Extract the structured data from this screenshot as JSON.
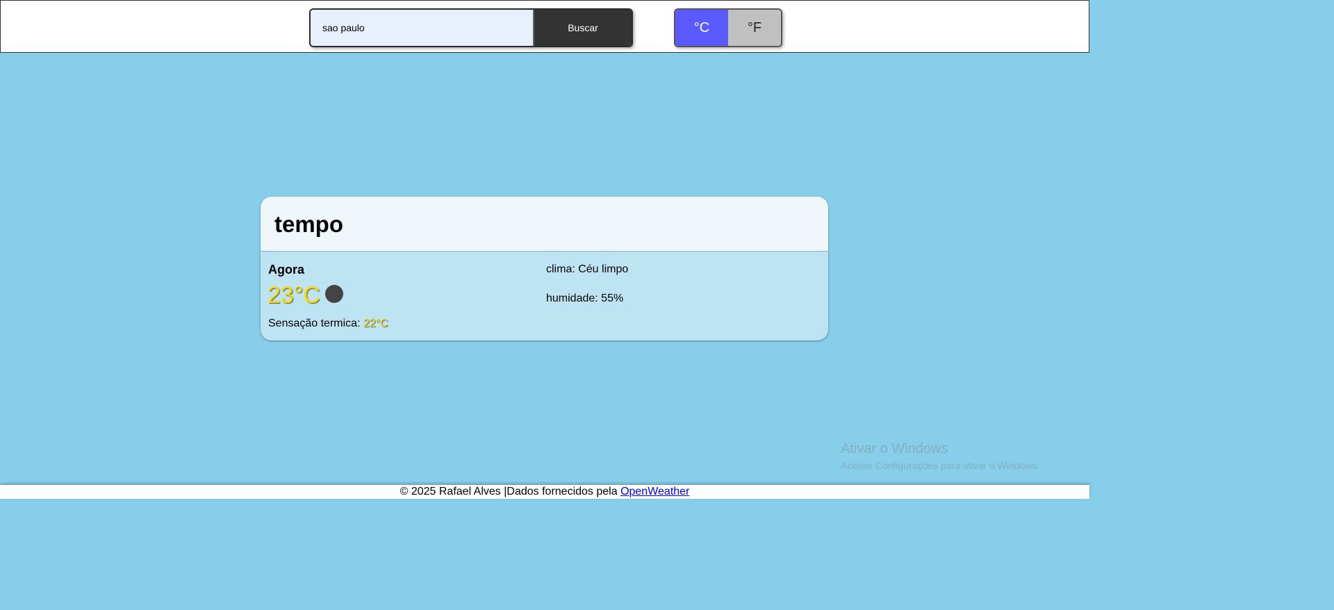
{
  "search": {
    "value": "sao paulo",
    "button_label": "Buscar"
  },
  "units": {
    "celsius_label": "°C",
    "fahrenheit_label": "°F",
    "selected": "°C"
  },
  "card": {
    "title": "tempo",
    "now_label": "Agora",
    "temperature": "23°C",
    "feels_like_label": "Sensação termica: ",
    "feels_like_value": "22°C",
    "condition": "clima: Céu limpo",
    "humidity": "humidade: 55%",
    "icon": "dark-circle-icon"
  },
  "watermark": {
    "title": "Ativar o Windows",
    "subtitle": "Acesse Configurações para ativar o Windows."
  },
  "footer": {
    "text": "© 2025 Rafael Alves |Dados fornecidos pela ",
    "link_label": "OpenWeather"
  },
  "colors": {
    "background": "#87ceeb",
    "accent_celsius": "#5a5aff",
    "temperature": "#ffd700"
  }
}
